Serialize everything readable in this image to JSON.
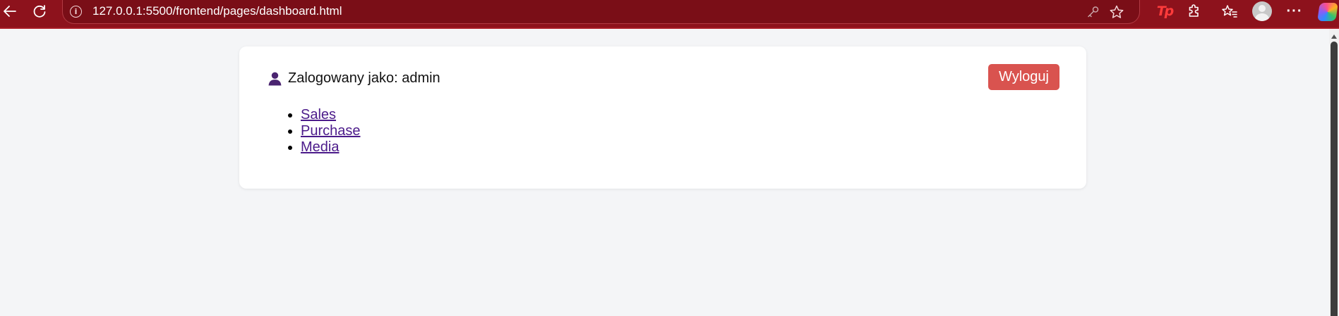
{
  "browser": {
    "url": "127.0.0.1:5500/frontend/pages/dashboard.html",
    "icons": [
      "back-icon",
      "refresh-icon",
      "site-info-icon",
      "key-icon",
      "favorite-star-icon",
      "tp-extension-icon",
      "extensions-icon",
      "favorites-icon",
      "profile-avatar",
      "more-menu-icon",
      "copilot-icon"
    ],
    "extension_text": "Tp",
    "info_glyph": "i",
    "menu_glyph": "···",
    "colors": {
      "toolbar": "#8d121c",
      "address": "#7a0e17"
    }
  },
  "dashboard": {
    "user_label": "Zalogowany jako: admin",
    "logout_label": "Wyloguj",
    "nav_links": [
      "Sales",
      "Purchase",
      "Media"
    ],
    "colors": {
      "logout": "#d9534f",
      "link": "#4b1a8a",
      "user_icon": "#4a2470",
      "background": "#f4f5f7"
    }
  }
}
